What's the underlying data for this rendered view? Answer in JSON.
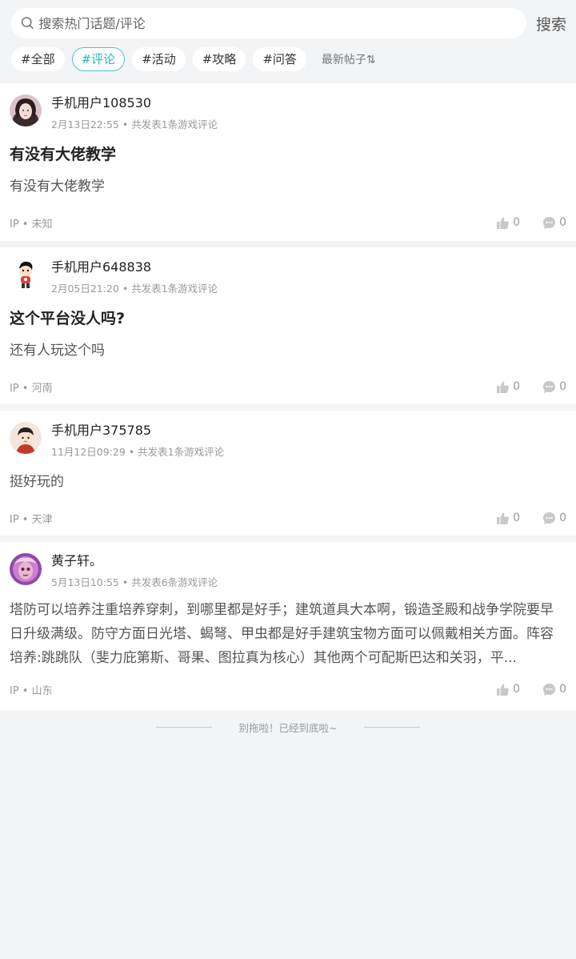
{
  "search": {
    "placeholder": "搜索热门话题/评论",
    "button_label": "搜索"
  },
  "tags": [
    {
      "label": "#全部"
    },
    {
      "label": "#评论"
    },
    {
      "label": "#活动"
    },
    {
      "label": "#攻略"
    },
    {
      "label": "#问答"
    }
  ],
  "sort_label": "最新帖子⇅",
  "posts": [
    {
      "user": "手机用户108530",
      "meta": "2月13日22:55 • 共发表1条游戏评论",
      "title": "有没有大佬教学",
      "body": "有没有大佬教学",
      "ip": "IP • 未知",
      "likes": "0",
      "comments": "0"
    },
    {
      "user": "手机用户648838",
      "meta": "2月05日21:20 • 共发表1条游戏评论",
      "title": "这个平台没人吗?",
      "body": "还有人玩这个吗",
      "ip": "IP • 河南",
      "likes": "0",
      "comments": "0"
    },
    {
      "user": "手机用户375785",
      "meta": "11月12日09:29 • 共发表1条游戏评论",
      "title": "",
      "body": "挺好玩的",
      "ip": "IP • 天津",
      "likes": "0",
      "comments": "0"
    },
    {
      "user": "黄子轩。",
      "meta": "5月13日10:55 • 共发表6条游戏评论",
      "title": "",
      "body": "塔防可以培养注重培养穿刺，到哪里都是好手；建筑道具大本啊，锻造圣殿和战争学院要早日升级满级。防守方面日光塔、蝎弩、甲虫都是好手建筑宝物方面可以佩戴相关方面。阵容培养:跳跳队（斐力庇第斯、哥果、图拉真为核心）其他两个可配斯巴达和关羽，平...",
      "ip": "IP • 山东",
      "likes": "0",
      "comments": "0"
    }
  ],
  "end_text": "别拖啦！已经到底啦~",
  "colors": {
    "accent": "#2fb6bd",
    "background": "#f3f4f6",
    "muted": "#999999"
  }
}
